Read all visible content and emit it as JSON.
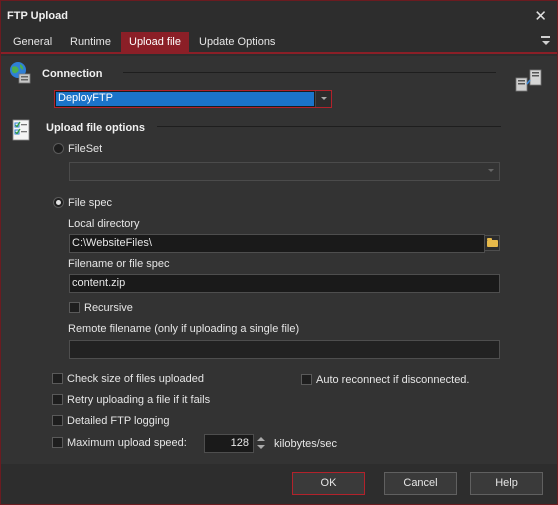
{
  "window": {
    "title": "FTP Upload"
  },
  "tabs": [
    {
      "label": "General"
    },
    {
      "label": "Runtime"
    },
    {
      "label": "Upload file"
    },
    {
      "label": "Update Options"
    }
  ],
  "connection": {
    "heading": "Connection",
    "selected": "DeployFTP"
  },
  "upload_options": {
    "heading": "Upload file options",
    "fileset_label": "FileSet",
    "fileset_value": "",
    "filespec_label": "File spec",
    "local_dir_label": "Local directory",
    "local_dir_value": "C:\\WebsiteFiles\\",
    "filename_label": "Filename or file spec",
    "filename_value": "content.zip",
    "recursive_label": "Recursive",
    "remote_label": "Remote filename (only if uploading a single file)",
    "remote_value": ""
  },
  "options": {
    "check_size": "Check size of files uploaded",
    "auto_reconnect": "Auto reconnect if disconnected.",
    "retry": "Retry uploading a file if it fails",
    "detailed_logging": "Detailed FTP logging",
    "max_speed": "Maximum upload speed:",
    "max_speed_value": "128",
    "speed_unit": "kilobytes/sec"
  },
  "buttons": {
    "ok": "OK",
    "cancel": "Cancel",
    "help": "Help"
  },
  "colors": {
    "accent": "#8b1f27",
    "selection": "#1b74c9",
    "background": "#333333"
  }
}
